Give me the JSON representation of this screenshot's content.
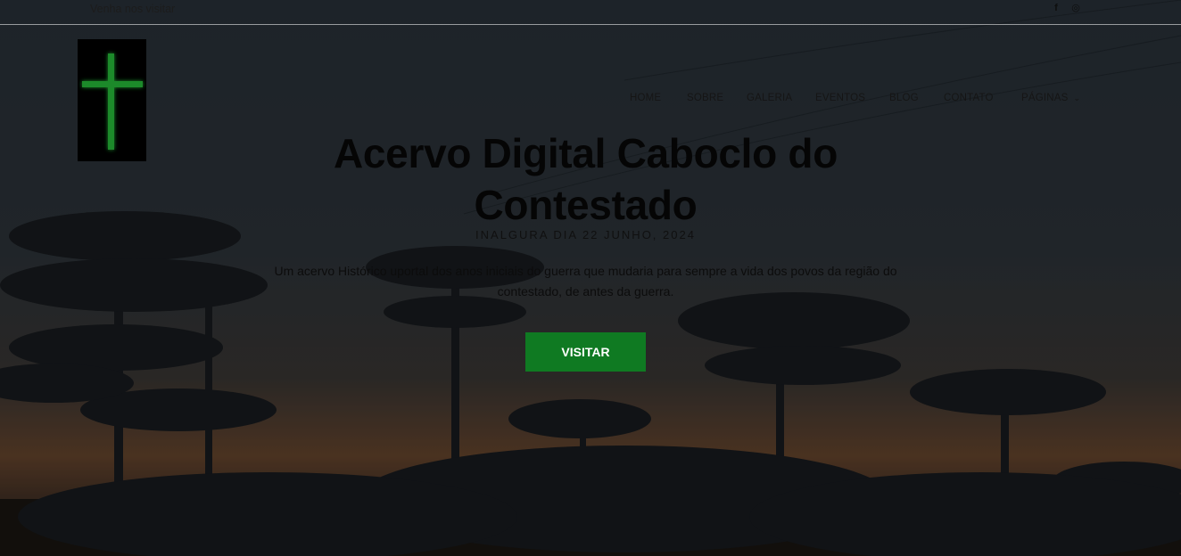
{
  "topbar": {
    "text": "Venha nos visitar",
    "social": [
      {
        "icon": "facebook-icon",
        "glyph": "f"
      },
      {
        "icon": "instagram-icon",
        "glyph": "◎"
      }
    ]
  },
  "logo": {
    "icon": "green-cross-logo",
    "color": "#1a8a2a"
  },
  "nav": {
    "items": [
      {
        "label": "HOME"
      },
      {
        "label": "SOBRE"
      },
      {
        "label": "GALERIA"
      },
      {
        "label": "EVENTOS"
      },
      {
        "label": "BLOG"
      },
      {
        "label": "CONTATO"
      },
      {
        "label": "PÁGINAS",
        "chevron": "⌄"
      }
    ]
  },
  "hero": {
    "title": "Acervo Digital Caboclo do Contestado",
    "subtitle": "INALGURA DIA 22 JUNHO, 2024",
    "description": "Um acervo Histórico uportal dos anos iniciais do guerra que mudaria para sempre a vida dos povos da região do contestado, de antes da guerra.",
    "cta_label": "VISITAR",
    "cta_color": "#0f7a22"
  }
}
